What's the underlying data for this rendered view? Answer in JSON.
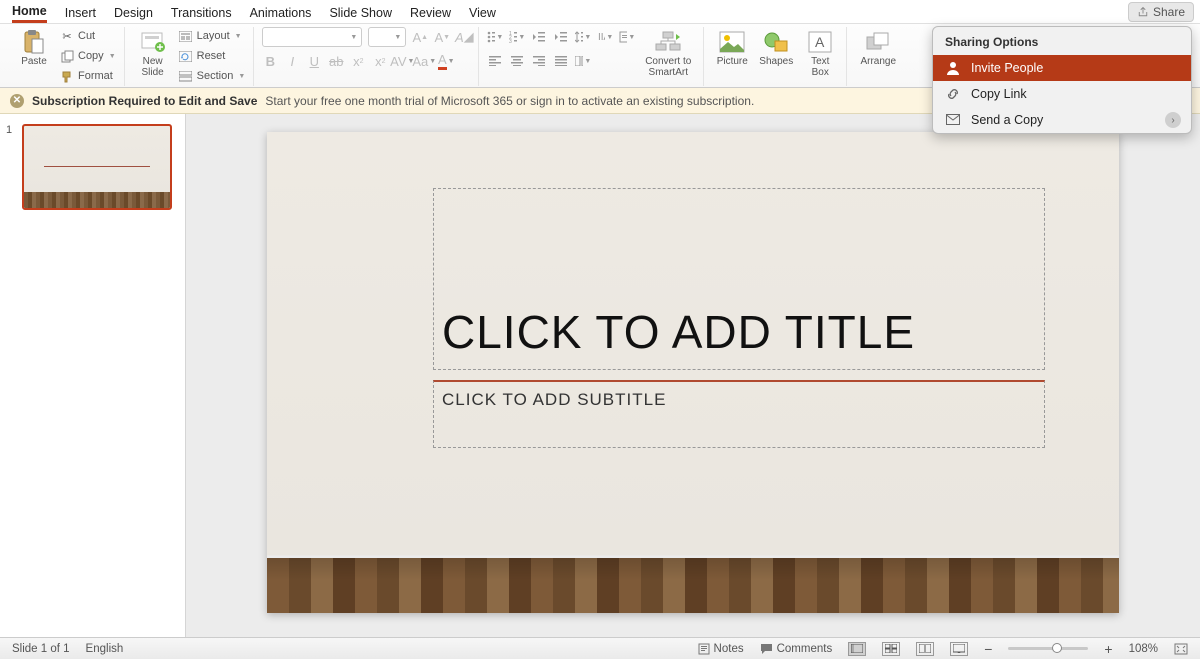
{
  "tabs": [
    "Home",
    "Insert",
    "Design",
    "Transitions",
    "Animations",
    "Slide Show",
    "Review",
    "View"
  ],
  "active_tab": 0,
  "share_label": "Share",
  "ribbon": {
    "paste": "Paste",
    "cut": "Cut",
    "copy": "Copy",
    "format": "Format",
    "new_slide": "New\nSlide",
    "layout": "Layout",
    "reset": "Reset",
    "section": "Section",
    "convert": "Convert to\nSmartArt",
    "picture": "Picture",
    "shapes": "Shapes",
    "textbox": "Text\nBox",
    "arrange": "Arrange"
  },
  "banner": {
    "title": "Subscription Required to Edit and Save",
    "msg": "Start your free one month trial of Microsoft 365 or sign in to activate an existing subscription."
  },
  "slide": {
    "number": "1",
    "title_ph": "CLICK TO ADD TITLE",
    "subtitle_ph": "CLICK TO ADD SUBTITLE"
  },
  "status": {
    "slide": "Slide 1 of 1",
    "lang": "English",
    "notes": "Notes",
    "comments": "Comments",
    "zoom": "108%"
  },
  "popover": {
    "heading": "Sharing Options",
    "invite": "Invite People",
    "copylink": "Copy Link",
    "sendcopy": "Send a Copy"
  }
}
